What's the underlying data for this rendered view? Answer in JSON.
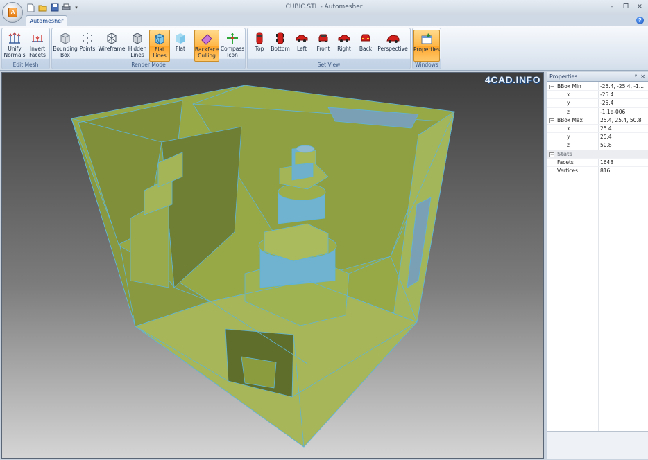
{
  "window": {
    "title": "CUBIC.STL - Automesher",
    "app_icon_letter": "A",
    "controls": {
      "minimize": "–",
      "restore": "❐",
      "close": "✕"
    }
  },
  "quick_access": {
    "items": [
      "new-file-icon",
      "open-folder-icon",
      "save-icon",
      "print-icon"
    ],
    "dropdown": "▾"
  },
  "tabs": [
    {
      "label": "Automesher",
      "active": true
    }
  ],
  "help_glyph": "?",
  "ribbon": {
    "groups": [
      {
        "label": "Edit Mesh",
        "buttons": [
          {
            "label": "Unify\nNormals",
            "icon": "unify-normals-icon"
          },
          {
            "label": "Invert\nFacets",
            "icon": "invert-facets-icon"
          }
        ]
      },
      {
        "label": "Render Mode",
        "buttons": [
          {
            "label": "Bounding\nBox",
            "icon": "bounding-box-icon"
          },
          {
            "label": "Points",
            "icon": "points-icon"
          },
          {
            "label": "Wireframe",
            "icon": "wireframe-icon"
          },
          {
            "label": "Hidden\nLines",
            "icon": "hidden-lines-icon"
          },
          {
            "label": "Flat\nLines",
            "icon": "flat-lines-icon",
            "active": true
          },
          {
            "label": "Flat",
            "icon": "flat-icon"
          },
          {
            "label": "Backface\nCulling",
            "icon": "backface-culling-icon",
            "active": true
          },
          {
            "label": "Compass\nIcon",
            "icon": "compass-icon"
          }
        ]
      },
      {
        "label": "Set View",
        "buttons": [
          {
            "label": "Top",
            "icon": "car-top-icon"
          },
          {
            "label": "Bottom",
            "icon": "car-bottom-icon"
          },
          {
            "label": "Left",
            "icon": "car-left-icon"
          },
          {
            "label": "Front",
            "icon": "car-front-icon"
          },
          {
            "label": "Right",
            "icon": "car-right-icon"
          },
          {
            "label": "Back",
            "icon": "car-back-icon"
          },
          {
            "label": "Perspective",
            "icon": "car-perspective-icon"
          }
        ]
      },
      {
        "label": "Windows",
        "buttons": [
          {
            "label": "Properties",
            "icon": "properties-icon",
            "active": true
          }
        ]
      }
    ]
  },
  "viewport": {
    "watermark": "4CAD.INFO",
    "mesh_color": "#9aab4a",
    "edge_color": "#5fb4d8"
  },
  "properties": {
    "title": "Properties",
    "pin": "ᴾ",
    "close": "✕",
    "rows": [
      {
        "type": "group",
        "key": "BBox Min",
        "value": "-25.4, -25.4, -1..."
      },
      {
        "type": "sub",
        "key": "x",
        "value": "-25.4"
      },
      {
        "type": "sub",
        "key": "y",
        "value": "-25.4"
      },
      {
        "type": "sub",
        "key": "z",
        "value": "-1.1e-006"
      },
      {
        "type": "group",
        "key": "BBox Max",
        "value": "25.4, 25.4, 50.8"
      },
      {
        "type": "sub",
        "key": "x",
        "value": "25.4"
      },
      {
        "type": "sub",
        "key": "y",
        "value": "25.4"
      },
      {
        "type": "sub",
        "key": "z",
        "value": "50.8"
      },
      {
        "type": "category",
        "key": "Stats",
        "value": ""
      },
      {
        "type": "item",
        "key": "Facets",
        "value": "1648"
      },
      {
        "type": "item",
        "key": "Vertices",
        "value": "816"
      }
    ]
  }
}
